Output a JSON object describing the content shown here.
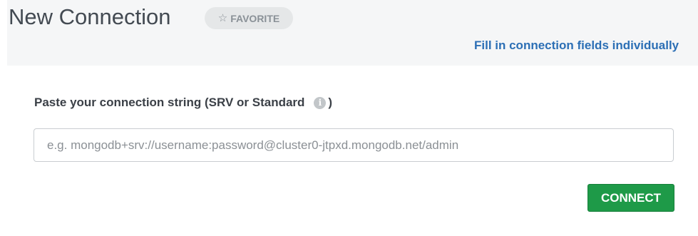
{
  "header": {
    "title": "New Connection",
    "favorite_label": "FAVORITE",
    "favorite_icon": "star-outline-icon",
    "fill_fields_link": "Fill in connection fields individually"
  },
  "form": {
    "label_prefix": "Paste your connection string (SRV or Standard",
    "label_suffix": ")",
    "info_icon": "info-icon",
    "info_glyph": "i",
    "input_value": "",
    "input_placeholder": "e.g. mongodb+srv://username:password@cluster0-jtpxd.mongodb.net/admin",
    "connect_label": "CONNECT"
  },
  "colors": {
    "header_bg": "#f5f6f7",
    "link": "#2c6fb5",
    "connect_green": "#1e9a48",
    "favorite_bg": "#e5e7e8"
  }
}
